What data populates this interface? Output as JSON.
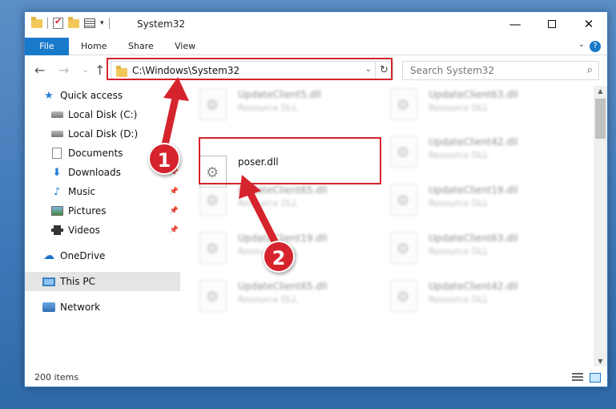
{
  "window": {
    "title": "System32",
    "controls": {
      "minimize": "—",
      "maximize": "",
      "close": "✕"
    }
  },
  "ribbon": {
    "tabs": [
      "File",
      "Home",
      "Share",
      "View"
    ],
    "help": "?",
    "collapse": "⌄"
  },
  "navbar": {
    "back": "←",
    "forward": "→",
    "recent": "⌄",
    "up": "↑",
    "address": "C:\\Windows\\System32",
    "address_dropdown": "⌄",
    "refresh": "↻",
    "search_placeholder": "Search System32",
    "search_icon": "⌕"
  },
  "sidebar": {
    "items": [
      {
        "label": "Quick access",
        "icon": "star-icon",
        "pinned": false
      },
      {
        "label": "Local Disk (C:)",
        "icon": "drive-icon",
        "pinned": false
      },
      {
        "label": "Local Disk (D:)",
        "icon": "drive-icon",
        "pinned": false
      },
      {
        "label": "Documents",
        "icon": "documents-icon",
        "pinned": false
      },
      {
        "label": "Downloads",
        "icon": "download-icon",
        "pinned": true
      },
      {
        "label": "Music",
        "icon": "music-icon",
        "pinned": true
      },
      {
        "label": "Pictures",
        "icon": "pictures-icon",
        "pinned": true
      },
      {
        "label": "Videos",
        "icon": "videos-icon",
        "pinned": true
      },
      {
        "label": "OneDrive",
        "icon": "cloud-icon",
        "pinned": false
      },
      {
        "label": "This PC",
        "icon": "computer-icon",
        "pinned": false,
        "selected": true
      },
      {
        "label": "Network",
        "icon": "network-icon",
        "pinned": false
      }
    ],
    "pin_glyph": "📌"
  },
  "files": [
    {
      "name": "UpdateClient5.dll",
      "type": "Resource DLL",
      "blurred": true
    },
    {
      "name": "UpdateClient63.dll",
      "type": "Resource DLL",
      "blurred": true
    },
    {
      "name": "poser.dll",
      "type": "",
      "blurred": false,
      "highlighted": true
    },
    {
      "name": "UpdateClient42.dll",
      "type": "Resource DLL",
      "blurred": true
    },
    {
      "name": "UpdateClient65.dll",
      "type": "Resource DLL",
      "blurred": true
    },
    {
      "name": "UpdateClient19.dll",
      "type": "Resource DLL",
      "blurred": true
    },
    {
      "name": "UpdateClient19.dll",
      "type": "Resource DLL",
      "blurred": true
    },
    {
      "name": "UpdateClient63.dll",
      "type": "Resource DLL",
      "blurred": true
    },
    {
      "name": "UpdateClient65.dll",
      "type": "Resource DLL",
      "blurred": true
    },
    {
      "name": "UpdateClient42.dll",
      "type": "Resource DLL",
      "blurred": true
    }
  ],
  "scrollbar": {
    "up": "▲",
    "down": "▼"
  },
  "status": {
    "item_count": "200 items"
  },
  "annotations": {
    "badge_1": "1",
    "badge_2": "2",
    "color": "#d5242d"
  }
}
